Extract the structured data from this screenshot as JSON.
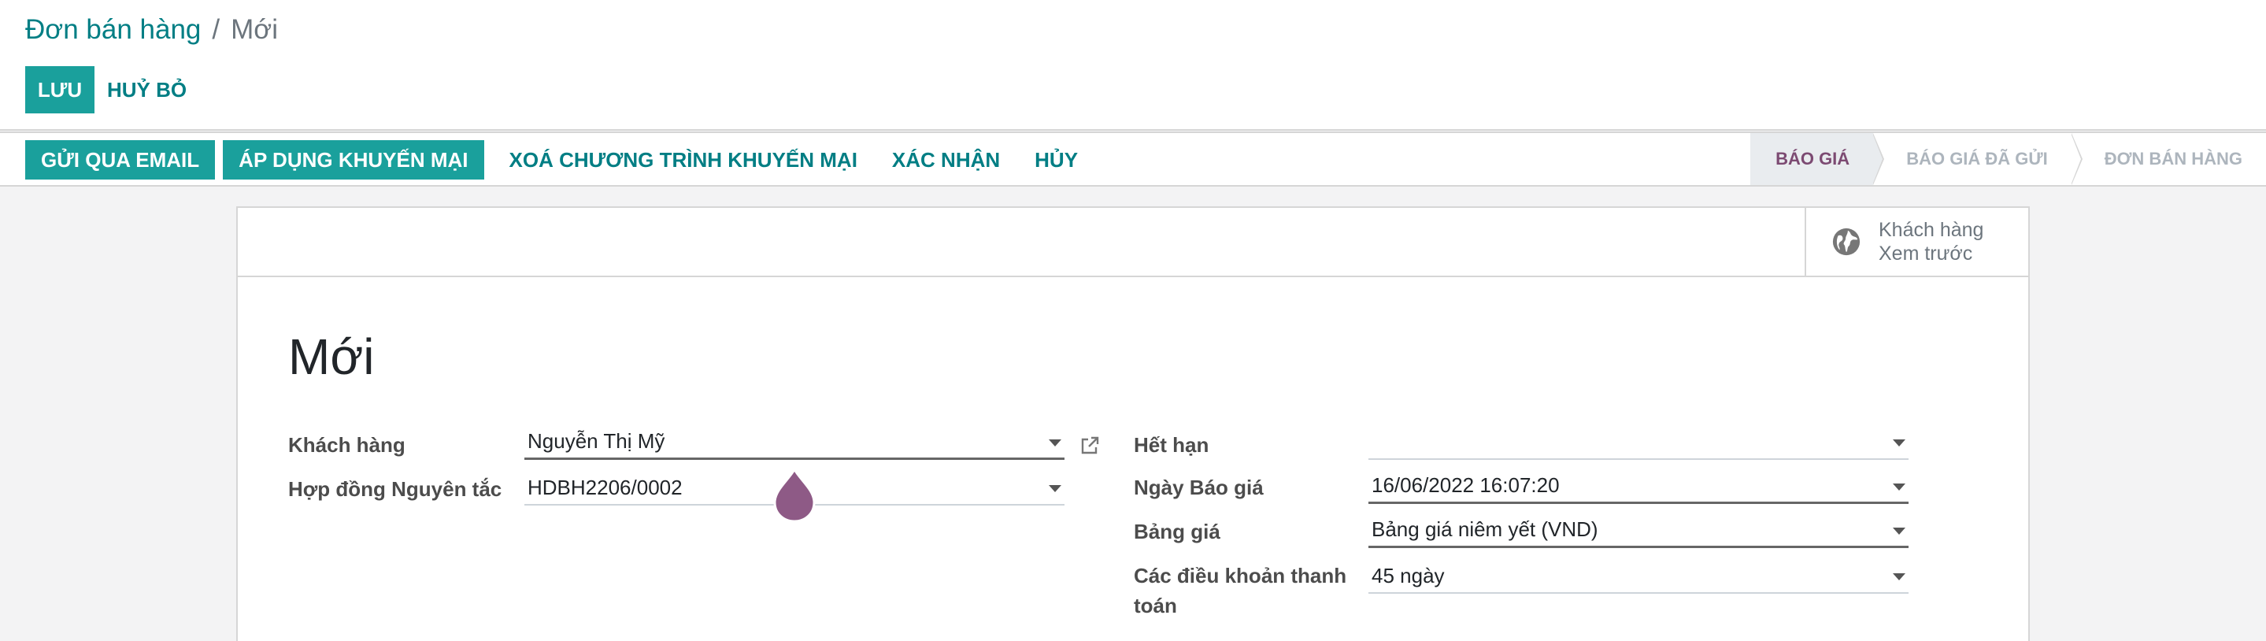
{
  "breadcrumb": {
    "parent": "Đơn bán hàng",
    "separator": "/",
    "current": "Mới"
  },
  "control": {
    "save_label": "LƯU",
    "discard_label": "HUỶ BỎ"
  },
  "statusbar": {
    "buttons": [
      "GỬI QUA EMAIL",
      "ÁP DỤNG KHUYẾN MẠI"
    ],
    "links": [
      "XOÁ CHƯƠNG TRÌNH KHUYẾN MẠI",
      "XÁC NHẬN",
      "HỦY"
    ],
    "stages": [
      "BÁO GIÁ",
      "BÁO GIÁ ĐÃ GỬI",
      "ĐƠN BÁN HÀNG"
    ],
    "active_stage": "BÁO GIÁ"
  },
  "stat_button": {
    "line1": "Khách hàng",
    "line2": "Xem trước",
    "icon": "globe-icon"
  },
  "form": {
    "title": "Mới",
    "customer_label": "Khách hàng",
    "customer_value": "Nguyễn Thị Mỹ",
    "contract_label": "Hợp đồng Nguyên tắc",
    "contract_value": "HDBH2206/0002",
    "expiry_label": "Hết hạn",
    "expiry_value": "",
    "quote_date_label": "Ngày Báo giá",
    "quote_date_value": "16/06/2022 16:07:20",
    "pricelist_label": "Bảng giá",
    "pricelist_value": "Bảng giá niêm yết (VND)",
    "payment_terms_label_1": "Các điều khoản thanh",
    "payment_terms_label_2": "toán",
    "payment_terms_value": "45 ngày"
  },
  "colors": {
    "primary": "#1aa09c",
    "link": "#017e84",
    "active_stage": "#7c4a72",
    "cursor": "#8e5a86"
  }
}
